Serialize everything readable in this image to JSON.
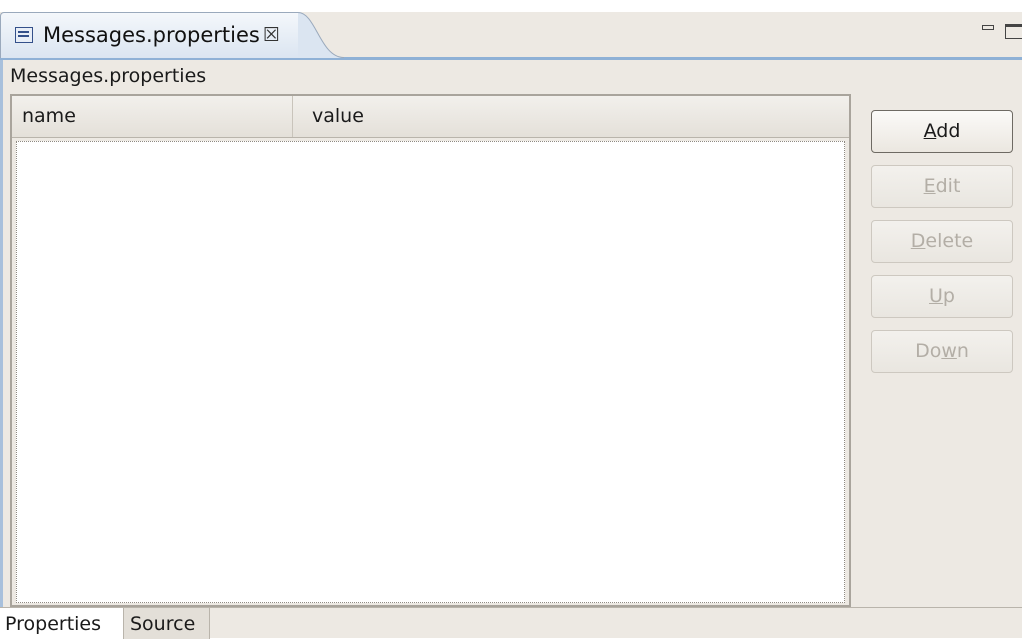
{
  "editor": {
    "tab_title": "Messages.properties",
    "tab_close": "☒",
    "header_label": "Messages.properties"
  },
  "table": {
    "columns": [
      "name",
      "value"
    ],
    "rows": []
  },
  "buttons": [
    {
      "pre": "",
      "mnemonic": "A",
      "post": "dd",
      "enabled": true
    },
    {
      "pre": "",
      "mnemonic": "E",
      "post": "dit",
      "enabled": false
    },
    {
      "pre": "",
      "mnemonic": "D",
      "post": "elete",
      "enabled": false
    },
    {
      "pre": "",
      "mnemonic": "U",
      "post": "p",
      "enabled": false
    },
    {
      "pre": "Do",
      "mnemonic": "w",
      "post": "n",
      "enabled": false
    }
  ],
  "bottom_tabs": [
    "Properties",
    "Source"
  ],
  "colors": {
    "accent": "#8fb1d6",
    "panel": "#ede9e3",
    "disabled_text": "#b3aea6"
  }
}
